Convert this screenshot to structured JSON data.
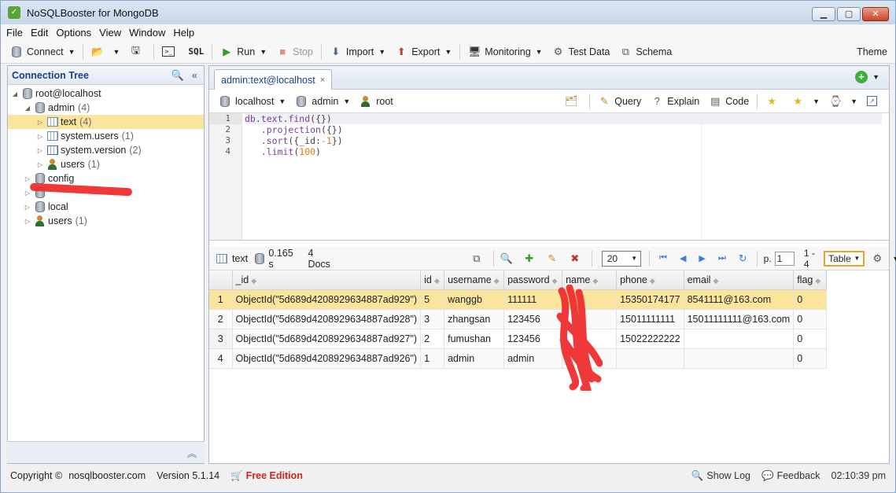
{
  "window": {
    "title": "NoSQLBooster for MongoDB",
    "minimize": "▁",
    "maximize": "▢",
    "close": "✕"
  },
  "menu": [
    "File",
    "Edit",
    "Options",
    "View",
    "Window",
    "Help"
  ],
  "toolbar": {
    "connect": "Connect",
    "sql": "SQL",
    "run": "Run",
    "stop": "Stop",
    "import": "Import",
    "export": "Export",
    "monitoring": "Monitoring",
    "test_data": "Test Data",
    "schema": "Schema",
    "theme": "Theme"
  },
  "connection_tree": {
    "title": "Connection Tree",
    "root": "root@localhost",
    "admin": {
      "label": "admin",
      "count": "(4)"
    },
    "text": {
      "label": "text",
      "count": "(4)"
    },
    "system_users": {
      "label": "system.users",
      "count": "(1)"
    },
    "system_version": {
      "label": "system.version",
      "count": "(2)"
    },
    "admin_users": {
      "label": "users",
      "count": "(1)"
    },
    "config": {
      "label": "config"
    },
    "local": {
      "label": "local"
    },
    "users": {
      "label": "users",
      "count": "(1)"
    }
  },
  "tab": {
    "label": "admin:text@localhost",
    "close": "×"
  },
  "query_bar": {
    "host": "localhost",
    "db": "admin",
    "user": "root",
    "query": "Query",
    "explain": "Explain",
    "code": "Code"
  },
  "editor": {
    "line_numbers": [
      "1",
      "2",
      "3",
      "4"
    ],
    "line1": {
      "obj": "db",
      "d1": ".",
      "coll": "text",
      "d2": ".",
      "fn": "find",
      "args": "({})"
    },
    "line2": {
      "indent": "   ",
      "fn": ".projection",
      "args": "({})"
    },
    "line3": {
      "indent": "   ",
      "fn": ".sort",
      "pre": "({_id:",
      "num": "-1",
      "post": "})"
    },
    "line4": {
      "indent": "   ",
      "fn": ".limit",
      "pre": "(",
      "num": "100",
      "post": ")"
    }
  },
  "result_bar": {
    "collection": "text",
    "time": "0.165 s",
    "docs": "4 Docs",
    "page_size": "20",
    "page_label": "p.",
    "page": "1",
    "range": "1 - 4",
    "view": "Table"
  },
  "table": {
    "columns": [
      "_id",
      "id",
      "username",
      "password",
      "name",
      "phone",
      "email",
      "flag"
    ],
    "rows": [
      {
        "n": "1",
        "_id": "ObjectId(\"5d689d4208929634887ad929\")",
        "id": "5",
        "username": "wanggb",
        "password": "111111",
        "name": "",
        "phone": "15350174177",
        "email": "8541111@163.com",
        "flag": "0"
      },
      {
        "n": "2",
        "_id": "ObjectId(\"5d689d4208929634887ad928\")",
        "id": "3",
        "username": "zhangsan",
        "password": "123456",
        "name": "",
        "phone": "15011111111",
        "email": "15011111111@163.com",
        "flag": "0"
      },
      {
        "n": "3",
        "_id": "ObjectId(\"5d689d4208929634887ad927\")",
        "id": "2",
        "username": "fumushan",
        "password": "123456",
        "name": "",
        "phone": "15022222222",
        "email": "",
        "flag": "0"
      },
      {
        "n": "4",
        "_id": "ObjectId(\"5d689d4208929634887ad926\")",
        "id": "1",
        "username": "admin",
        "password": "admin",
        "name": "",
        "phone": "",
        "email": "",
        "flag": "0"
      }
    ]
  },
  "status": {
    "copyright": "Copyright ©",
    "site": "nosqlbooster.com",
    "version": "Version 5.1.14",
    "edition": "Free Edition",
    "show_log": "Show Log",
    "feedback": "Feedback",
    "time": "02:10:39 pm"
  },
  "colors": {
    "selection": "#fbe59c",
    "accent": "#15428b",
    "free_edition": "#d4241c",
    "redaction": "#ee2d2d"
  }
}
